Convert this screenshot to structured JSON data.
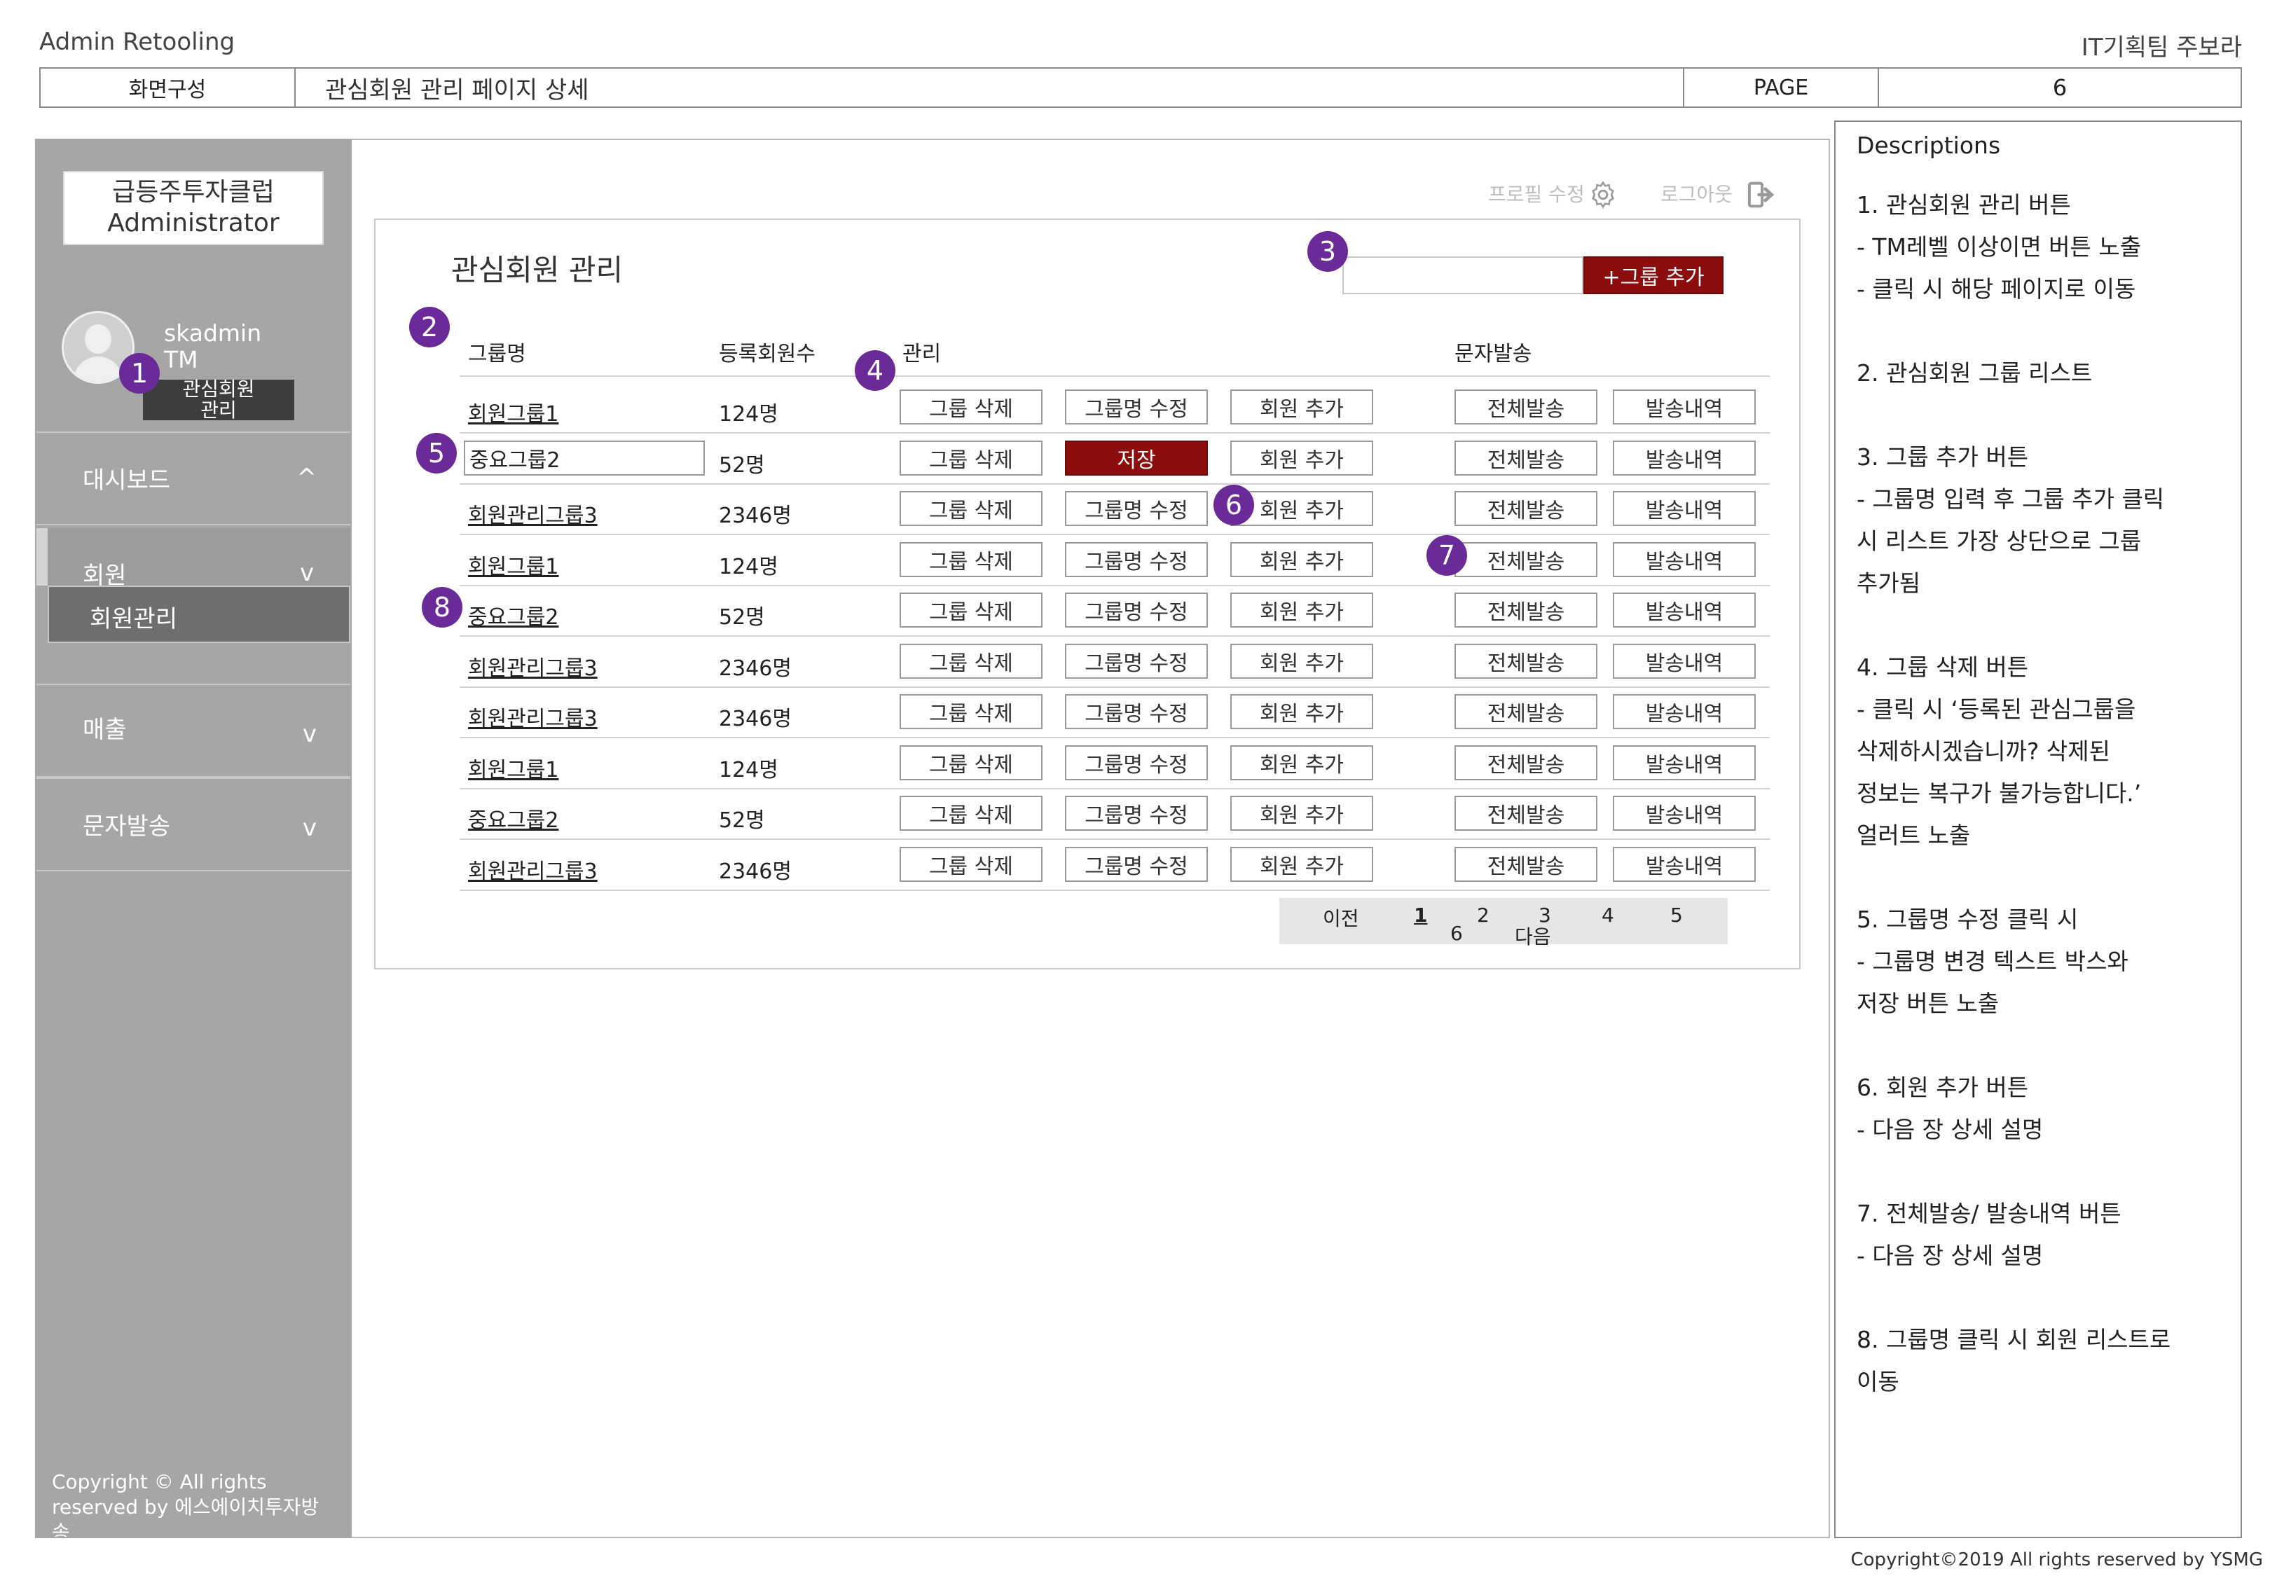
{
  "doc": {
    "title": "Admin Retooling",
    "team": "IT기획팀 주보라",
    "header": {
      "section_label": "화면구성",
      "page_name": "관심회원 관리 페이지 상세",
      "page_label": "PAGE",
      "page_number": "6"
    },
    "footer": "Copyright©2019 All rights reserved by YSMG"
  },
  "sidebar": {
    "brand_line1": "급등주투자클럽",
    "brand_line2": "Administrator",
    "user_name": "skadmin",
    "user_role": "TM",
    "interest_btn_line1": "관심회원",
    "interest_btn_line2": "관리",
    "menu": [
      {
        "label": "대시보드",
        "chevron": "^"
      },
      {
        "label": "회원",
        "chevron": "v"
      },
      {
        "label": "매출",
        "chevron": "v"
      },
      {
        "label": "문자발송",
        "chevron": "v"
      }
    ],
    "submenu": {
      "label": "회원관리"
    },
    "copyright": "Copyright © All rights reserved by 에스에이치투자방송"
  },
  "topbar": {
    "profile_edit": "프로필 수정",
    "logout": "로그아웃"
  },
  "main": {
    "title": "관심회원 관리",
    "group_input": {
      "value": "",
      "placeholder": ""
    },
    "add_group_button": "+그룹 추가",
    "columns": {
      "group_name": "그룹명",
      "member_count": "등록회원수",
      "manage": "관리",
      "sms": "문자발송"
    },
    "buttons": {
      "delete": "그룹 삭제",
      "rename": "그룹명 수정",
      "save": "저장",
      "add_member": "회원 추가",
      "send_all": "전체발송",
      "history": "발송내역"
    },
    "rows": [
      {
        "name": "회원그룹1",
        "count": "124명",
        "editing": false
      },
      {
        "name": "중요그룹2",
        "count": "52명",
        "editing": true
      },
      {
        "name": "회원관리그룹3",
        "count": "2346명",
        "editing": false
      },
      {
        "name": "회원그룹1",
        "count": "124명",
        "editing": false
      },
      {
        "name": "중요그룹2",
        "count": "52명",
        "editing": false
      },
      {
        "name": "회원관리그룹3",
        "count": "2346명",
        "editing": false
      },
      {
        "name": "회원관리그룹3",
        "count": "2346명",
        "editing": false
      },
      {
        "name": "회원그룹1",
        "count": "124명",
        "editing": false
      },
      {
        "name": "중요그룹2",
        "count": "52명",
        "editing": false
      },
      {
        "name": "회원관리그룹3",
        "count": "2346명",
        "editing": false
      }
    ],
    "pagination": {
      "prev": "이전",
      "pages": [
        "1",
        "2",
        "3",
        "4",
        "5",
        "6"
      ],
      "current": "1",
      "next": "다음"
    }
  },
  "callouts": [
    "1",
    "2",
    "3",
    "4",
    "5",
    "6",
    "7",
    "8"
  ],
  "descriptions": {
    "title": "Descriptions",
    "lines": [
      "1. 관심회원 관리 버튼",
      "-    TM레벨 이상이면 버튼 노출",
      "-    클릭 시 해당 페이지로 이동",
      "2. 관심회원 그룹 리스트",
      "3. 그룹 추가 버튼",
      "-    그룹명 입력 후 그룹 추가 클릭",
      "      시 리스트 가장 상단으로 그룹",
      "      추가됨",
      "4. 그룹 삭제 버튼",
      "-    클릭 시 ‘등록된 관심그룹을",
      "      삭제하시겠습니까? 삭제된",
      "      정보는 복구가 불가능합니다.’",
      "      얼러트 노출",
      "5. 그룹명 수정 클릭 시",
      "-    그룹명 변경 텍스트 박스와",
      "      저장 버튼 노출",
      "6. 회원 추가 버튼",
      "-    다음 장 상세 설명",
      "7. 전체발송/ 발송내역 버튼",
      "-    다음 장 상세 설명",
      "8. 그룹명 클릭 시 회원 리스트로",
      "이동"
    ]
  }
}
